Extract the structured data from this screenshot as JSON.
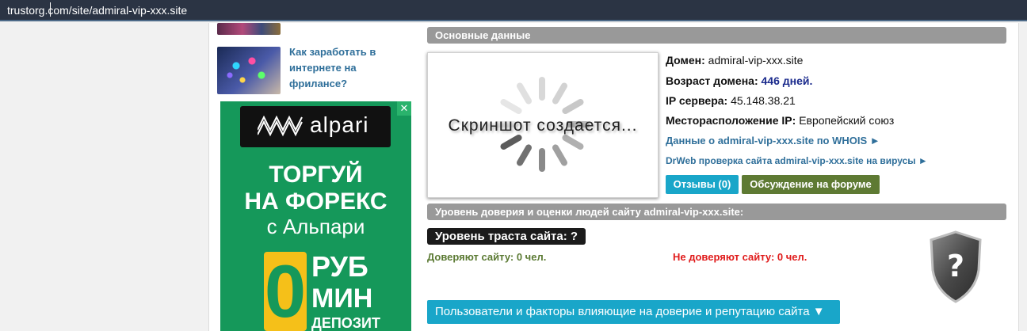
{
  "browser": {
    "url": "trustorg.com/site/admiral-vip-xxx.site"
  },
  "sidebar": {
    "article_link": "Как заработать в интернете на фрилансе?",
    "ad": {
      "close": "✕",
      "logo": "alpari",
      "headline_line1": "ТОРГУЙ",
      "headline_line2": "НА ФОРЕКС",
      "sub": "с Альпари",
      "zero": "0",
      "rub": "РУБ",
      "min": "МИН",
      "deposit": "ДЕПОЗИТ",
      "brand_color": "#15985a",
      "accent_color": "#f5c019"
    }
  },
  "main": {
    "basic_header": "Основные данные",
    "screenshot_text": "Скриншот создается...",
    "domain_label": "Домен:",
    "domain_value": "admiral-vip-xxx.site",
    "age_label": "Возраст домена:",
    "age_value": "446 дней.",
    "ip_label": "IP сервера:",
    "ip_value": "45.148.38.21",
    "geo_label": "Месторасположение IP:",
    "geo_value": "Европейский союз",
    "whois_link": "Данные о admiral-vip-xxx.site по WHOIS ►",
    "drweb_link": "DrWeb проверка сайта admiral-vip-xxx.site на вирусы ►",
    "reviews_button": "Отзывы (0)",
    "forum_button": "Обсуждение на форуме",
    "trust_header": "Уровень доверия и оценки людей сайту admiral-vip-xxx.site:",
    "trust_level": "Уровень траста сайта: ?",
    "trust_yes": "Доверяют сайту: 0 чел.",
    "trust_no": "Не доверяют сайту: 0 чел.",
    "shield_glyph": "?",
    "factors_button": "Пользователи и факторы влияющие на доверие и репутацию сайта ▼"
  },
  "colors": {
    "header_bar": "#2b3444",
    "section_head": "#999999",
    "link": "#2f6f9a",
    "reviews": "#19a6c9",
    "forum": "#5e7a33",
    "trust_yes": "#5b7a33",
    "trust_no": "#e01b1b"
  }
}
